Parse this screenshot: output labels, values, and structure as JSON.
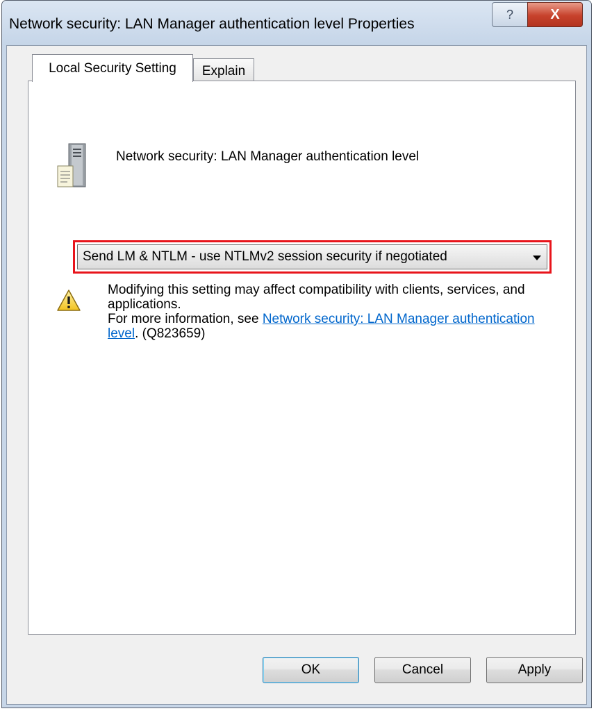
{
  "window": {
    "title": "Network security: LAN Manager authentication level Properties",
    "help_label": "?",
    "close_label": "X"
  },
  "tabs": [
    {
      "label": "Local Security Setting",
      "active": true
    },
    {
      "label": "Explain",
      "active": false
    }
  ],
  "policy": {
    "name": "Network security: LAN Manager authentication level",
    "icon": "server-policy-icon"
  },
  "dropdown": {
    "selected": "Send LM & NTLM - use NTLMv2 session security if negotiated",
    "highlight_color": "#e8141b"
  },
  "warning": {
    "icon": "warning-icon",
    "line1": "Modifying this setting may affect compatibility with clients, services, and applications.",
    "line2_prefix": "For more information, see ",
    "link_text": "Network security: LAN Manager authentication level",
    "line2_suffix": ". (Q823659)"
  },
  "buttons": {
    "ok": "OK",
    "cancel": "Cancel",
    "apply": "Apply"
  }
}
